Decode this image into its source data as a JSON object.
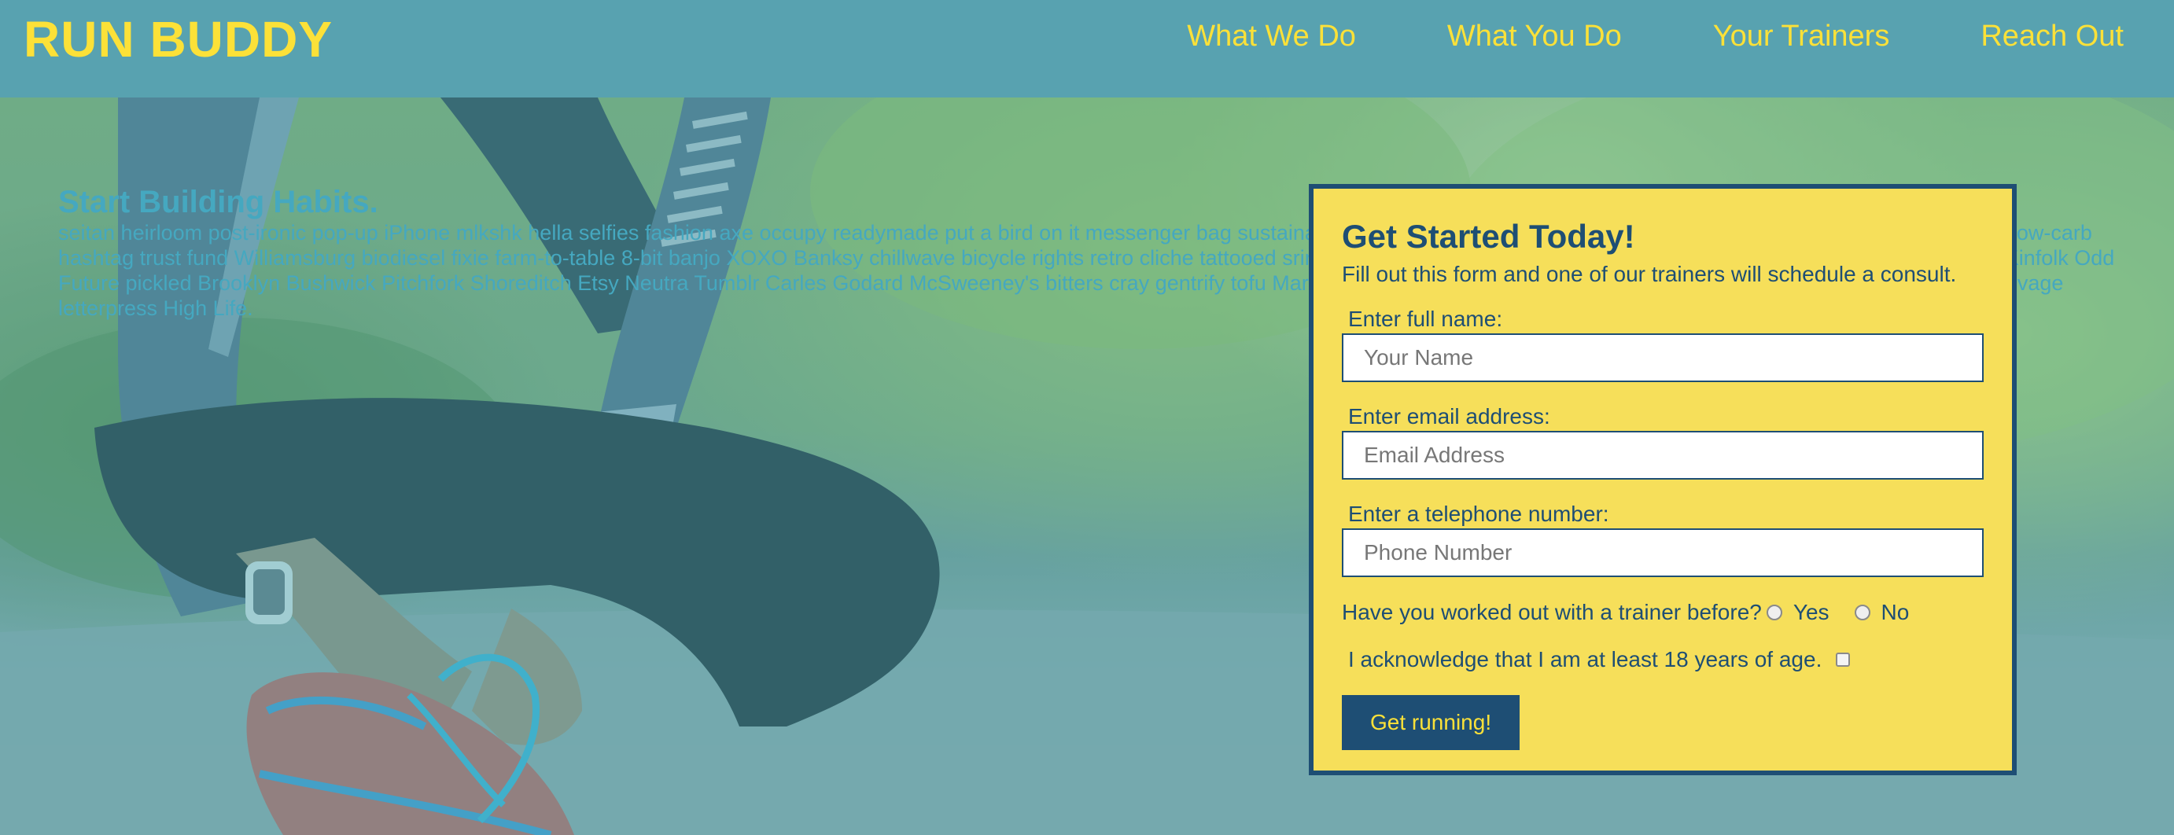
{
  "header": {
    "brand": "RUN BUDDY",
    "nav": [
      "What We Do",
      "What You Do",
      "Your Trainers",
      "Reach Out"
    ]
  },
  "intro": {
    "title": "Start Building Habits.",
    "body": "seitan heirloom post-ironic pop-up iPhone mlkshk hella selfies fashion axe occupy readymade put a bird on it messenger bag sustainable wayfarers literally mumblecore before they sold out organic kale chips low-carb hashtag trust fund Williamsburg biodiesel fixie farm-to-table 8-bit banjo XOXO Banksy chillwave bicycle rights retro cliche tattooed sriracha cardigan ethical direct trade tote bag Austin Pinterest artisan Schlitz Kinfolk Odd Future pickled Brooklyn Bushwick Pitchfork Shoreditch Etsy Neutra Tumblr Carles Godard McSweeney's bitters cray gentrify tofu Marfa you probably haven't heard of them yr banh mi asymmetrical art party selvage letterpress High Life."
  },
  "form": {
    "title": "Get Started Today!",
    "subtitle": "Fill out this form and one of our trainers will schedule a consult.",
    "name_label": "Enter full name:",
    "name_placeholder": "Your Name",
    "email_label": "Enter email address:",
    "email_placeholder": "Email Address",
    "phone_label": "Enter a telephone number:",
    "phone_placeholder": "Phone Number",
    "trainer_question": "Have you worked out with a trainer before?",
    "trainer_yes": "Yes",
    "trainer_no": "No",
    "age_ack": "I acknowledge that I am at least 18 years of age.",
    "submit_label": "Get running!"
  },
  "colors": {
    "header_bg": "#58a2b0",
    "accent_yellow": "#fce138",
    "panel_bg": "#f6df5a",
    "navy": "#1e4e74",
    "intro_text": "#45a8c0"
  }
}
